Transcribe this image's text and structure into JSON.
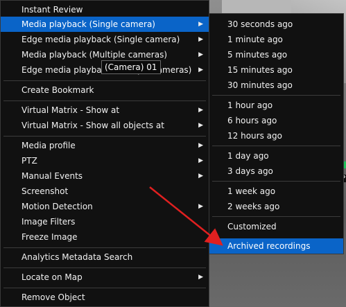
{
  "main_menu": {
    "items": [
      {
        "label": "Instant Review",
        "has_submenu": false
      },
      {
        "label": "Media playback (Single camera)",
        "has_submenu": true,
        "active": true
      },
      {
        "label": "Edge media playback (Single camera)",
        "has_submenu": true
      },
      {
        "label": "Media playback (Multiple cameras)",
        "has_submenu": true
      },
      {
        "label": "Edge media playback (Multiple cameras)",
        "has_submenu": true
      },
      {
        "label": "Create Bookmark",
        "has_submenu": false
      },
      {
        "label": "Virtual Matrix - Show at",
        "has_submenu": true
      },
      {
        "label": "Virtual Matrix - Show all objects at",
        "has_submenu": true
      },
      {
        "label": "Media profile",
        "has_submenu": true
      },
      {
        "label": "PTZ",
        "has_submenu": true
      },
      {
        "label": "Manual Events",
        "has_submenu": true
      },
      {
        "label": "Screenshot",
        "has_submenu": false
      },
      {
        "label": "Motion Detection",
        "has_submenu": true
      },
      {
        "label": "Image Filters",
        "has_submenu": false
      },
      {
        "label": "Freeze Image",
        "has_submenu": false
      },
      {
        "label": "Analytics Metadata Search",
        "has_submenu": false
      },
      {
        "label": "Locate on Map",
        "has_submenu": true
      },
      {
        "label": "Remove Object",
        "has_submenu": false
      }
    ]
  },
  "sub_menu": {
    "items": [
      {
        "label": "30 seconds ago"
      },
      {
        "label": "1 minute ago"
      },
      {
        "label": "5 minutes ago"
      },
      {
        "label": "15 minutes ago"
      },
      {
        "label": "30 minutes ago"
      },
      {
        "label": "1 hour ago"
      },
      {
        "label": "6 hours ago"
      },
      {
        "label": "12 hours ago"
      },
      {
        "label": "1 day ago"
      },
      {
        "label": "3 days ago"
      },
      {
        "label": "1 week ago"
      },
      {
        "label": "2 weeks ago"
      },
      {
        "label": "Customized"
      },
      {
        "label": "Archived recordings",
        "active": true
      }
    ]
  },
  "tooltip": {
    "text": "(Camera) 01"
  },
  "overlay": {
    "p_label": "P"
  },
  "colors": {
    "menu_bg": "#111111",
    "highlight": "#0a64c8",
    "arrow_annotation": "#e02020",
    "status_green": "#21c15a"
  },
  "icons": {
    "submenu_arrow": "triangle-right-icon",
    "annotation": "red-arrow-icon"
  }
}
